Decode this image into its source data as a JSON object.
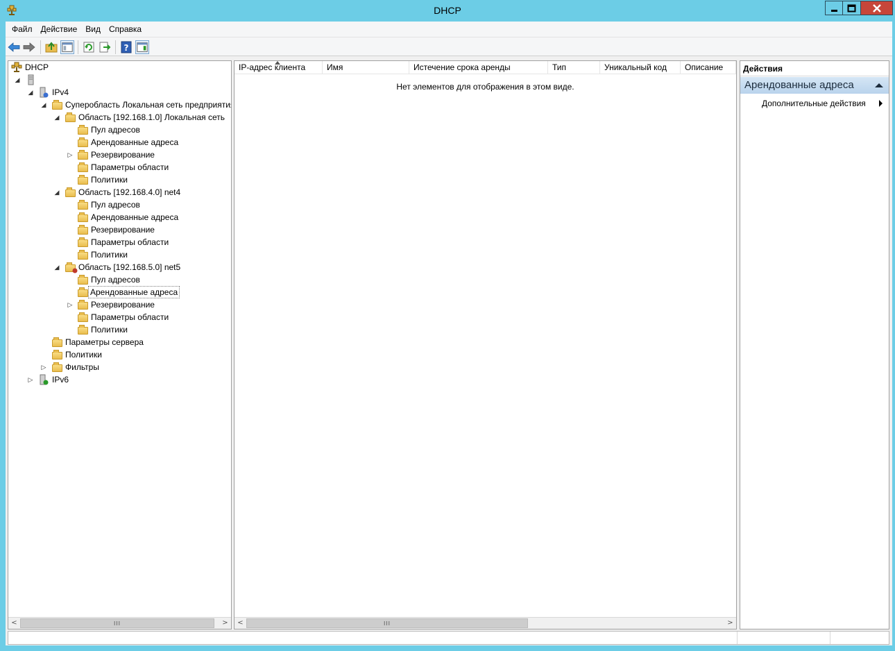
{
  "window": {
    "title": "DHCP"
  },
  "menu": {
    "items": [
      "Файл",
      "Действие",
      "Вид",
      "Справка"
    ]
  },
  "tree": {
    "root": "DHCP",
    "server": "",
    "ipv4": "IPv4",
    "superscope": "Суперобласть Локальная сеть предприятия",
    "scope1": "Область [192.168.1.0] Локальная сеть",
    "scope2": "Область [192.168.4.0] net4",
    "scope3": "Область [192.168.5.0] net5",
    "address_pool": "Пул адресов",
    "leases": "Арендованные адреса",
    "reservations": "Резервирование",
    "scope_options": "Параметры области",
    "policies": "Политики",
    "server_options": "Параметры сервера",
    "filters": "Фильтры",
    "ipv6": "IPv6"
  },
  "list": {
    "columns": [
      "IP-адрес клиента",
      "Имя",
      "Истечение срока аренды",
      "Тип",
      "Уникальный код",
      "Описание"
    ],
    "empty_message": "Нет элементов для отображения в этом виде."
  },
  "actions": {
    "header": "Действия",
    "section": "Арендованные адреса",
    "more": "Дополнительные действия"
  },
  "colors": {
    "titlebar": "#6ccde6",
    "close_button": "#c7463a",
    "selection_header": "#b9d3ec"
  }
}
